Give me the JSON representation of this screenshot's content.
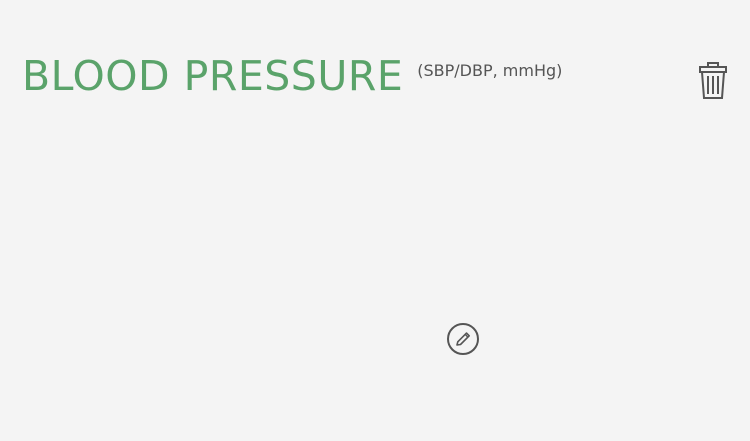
{
  "widget": {
    "title": "BLOOD PRESSURE",
    "subtitle": "(SBP/DBP, mmHg)",
    "delete_icon": "trash-icon",
    "edit_icon": "pencil-circle-icon",
    "accent_color": "#5aa36a",
    "background_color": "#f4f4f4",
    "icon_color": "#555555"
  }
}
